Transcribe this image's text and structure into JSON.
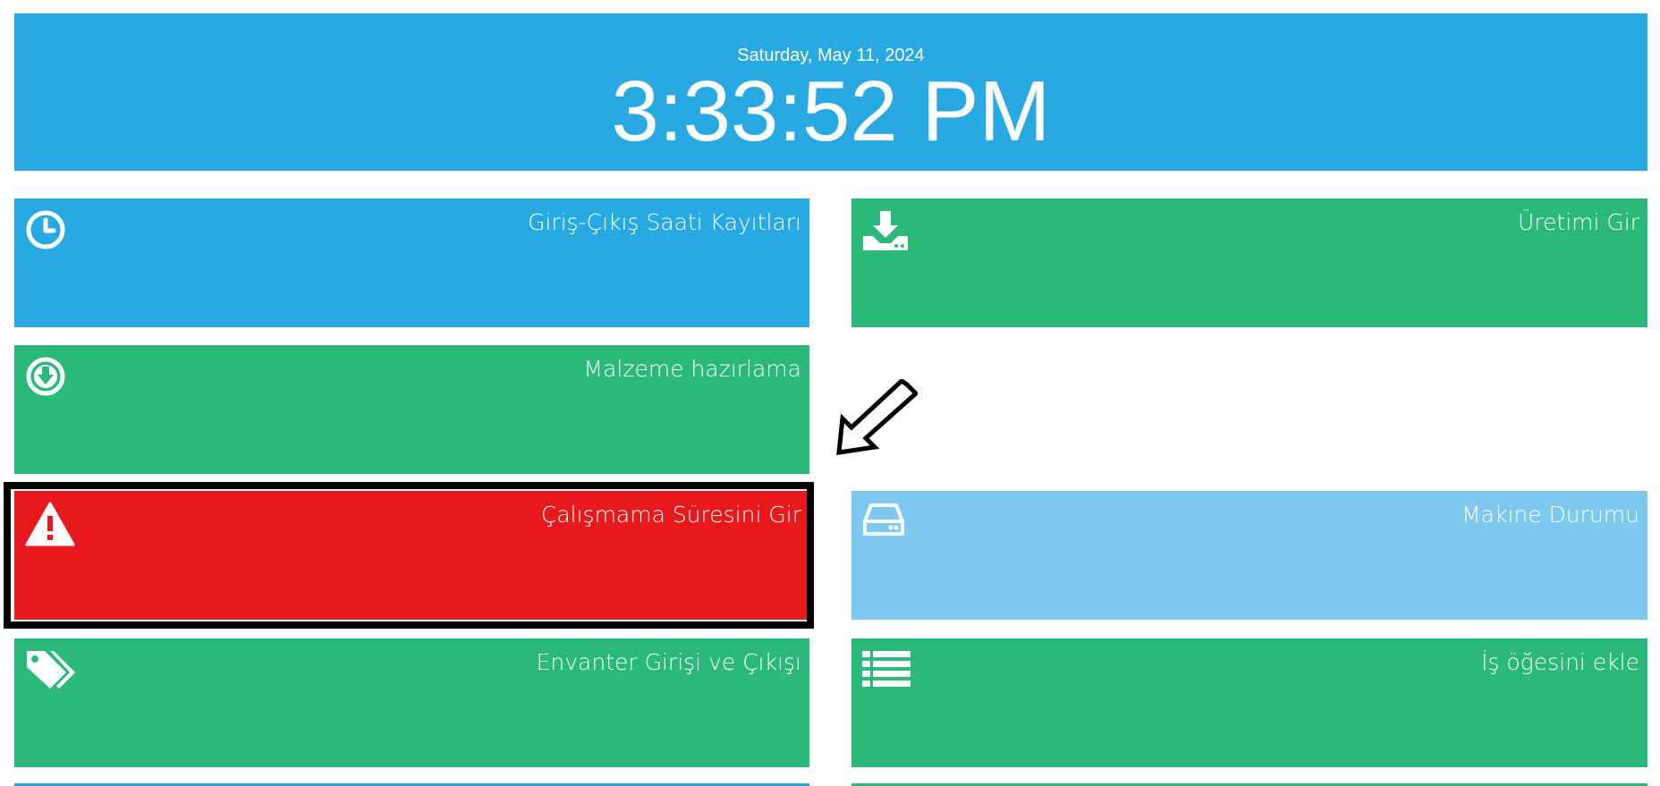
{
  "header": {
    "date": "Saturday, May 11, 2024",
    "time": "3:33:52 PM",
    "color": "#29a9e1"
  },
  "tiles": {
    "attendance": {
      "label": "Giriş-Çıkış Saati Kayıtları",
      "icon": "clock-icon",
      "color": "#29a9e1"
    },
    "production": {
      "label": "Üretimi Gir",
      "icon": "download-tray-icon",
      "color": "#2bb979"
    },
    "material": {
      "label": "Malzeme hazırlama",
      "icon": "circle-arrow-down-icon",
      "color": "#2bb979"
    },
    "downtime": {
      "label": "Çalışmama Süresini Gir",
      "icon": "warning-icon",
      "color": "#e8191d"
    },
    "machine": {
      "label": "Makine Durumu",
      "icon": "hard-drive-icon",
      "color": "#7ec9f0"
    },
    "inventory": {
      "label": "Envanter Girişi ve Çıkışı",
      "icon": "tags-icon",
      "color": "#2bb979"
    },
    "work_item": {
      "label": "İş öğesini ekle",
      "icon": "list-icon",
      "color": "#2bb979"
    }
  },
  "annotation": {
    "arrow_icon": "arrow-down-left-icon",
    "frame_color": "#000000"
  }
}
